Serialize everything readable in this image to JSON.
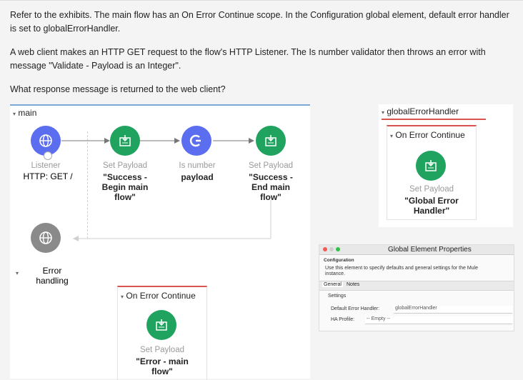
{
  "question": {
    "p1": "Refer to the exhibits. The main flow has an On Error Continue scope. In the Configuration global element, default error handler is set to globalErrorHandler.",
    "p2": "A web client makes an HTTP GET request to the flow's HTTP Listener. The Is number validator then throws an error with message \"Validate - Payload is an Integer\".",
    "p3": "What response message is returned to the web client?"
  },
  "main_flow": {
    "title": "main",
    "listener": {
      "type": "Listener",
      "name": "HTTP: GET /"
    },
    "set_payload_1": {
      "type": "Set Payload",
      "name_lines": [
        "\"Success -",
        "Begin main",
        "flow\""
      ]
    },
    "is_number": {
      "type": "Is number",
      "name": "payload"
    },
    "set_payload_2": {
      "type": "Set Payload",
      "name_lines": [
        "\"Success -",
        "End main",
        "flow\""
      ]
    },
    "error_handling": {
      "label_lines": [
        "Error",
        "handling"
      ]
    },
    "on_error_continue": {
      "title": "On Error Continue",
      "set_payload": {
        "type": "Set Payload",
        "name_lines": [
          "\"Error - main",
          "flow\""
        ]
      }
    }
  },
  "global_handler": {
    "title": "globalErrorHandler",
    "on_error_continue": {
      "title": "On Error Continue",
      "set_payload": {
        "type": "Set Payload",
        "name_lines": [
          "\"Global Error",
          "Handler\""
        ]
      }
    }
  },
  "properties": {
    "window_title": "Global Element Properties",
    "heading": "Configuration",
    "description_lines": [
      "Use this element to specify defaults and general settings for the Mule",
      "instance."
    ],
    "tabs": [
      "General",
      "Notes"
    ],
    "section": "Settings",
    "default_error_handler_label": "Default Error Handler:",
    "default_error_handler_value": "globalErrorHandler",
    "ha_profile_label": "HA Profile:",
    "ha_profile_value": "-- Empty --"
  },
  "colors": {
    "blue": "#5c6ef0",
    "green": "#1fa35e",
    "grey": "#8a8a8a",
    "accent_red": "#d9534f"
  }
}
